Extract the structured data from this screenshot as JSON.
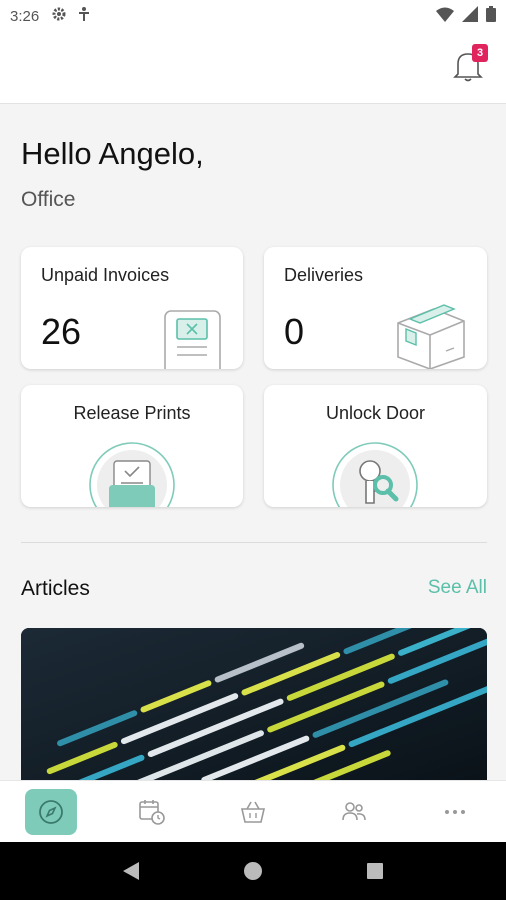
{
  "status_bar": {
    "time": "3:26"
  },
  "header": {
    "notification_count": "3"
  },
  "greeting": {
    "title": "Hello Angelo,",
    "location": "Office"
  },
  "cards": {
    "unpaid_invoices": {
      "label": "Unpaid Invoices",
      "count": "26"
    },
    "deliveries": {
      "label": "Deliveries",
      "count": "0"
    },
    "release_prints": {
      "label": "Release Prints"
    },
    "unlock_door": {
      "label": "Unlock Door"
    }
  },
  "articles": {
    "title": "Articles",
    "see_all": "See All"
  },
  "bottom_nav": {
    "items": [
      "compass-icon",
      "calendar-clock-icon",
      "basket-icon",
      "people-icon",
      "more-icon"
    ],
    "active": "compass-icon"
  },
  "colors": {
    "accent": "#5bbfa9",
    "accent_fill": "#7fcbb9",
    "badge": "#e0245e"
  }
}
